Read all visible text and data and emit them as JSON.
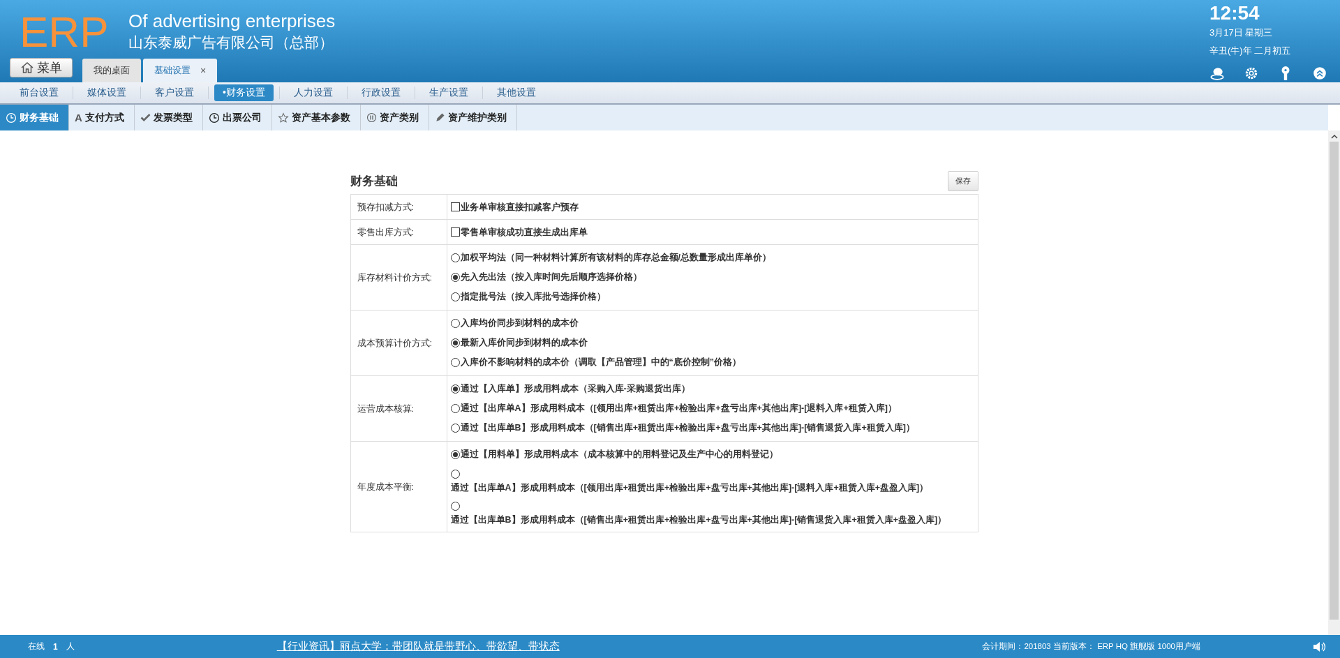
{
  "header": {
    "logo": "ERP",
    "title": "Of advertising enterprises",
    "company": "山东泰威广告有限公司（总部）",
    "clock": {
      "time": "12:54",
      "date": "3月17日 星期三",
      "lunar": "辛丑(牛)年 二月初五"
    }
  },
  "menu_button": {
    "label": "菜单"
  },
  "tabs": [
    {
      "label": "我的桌面",
      "selected": false
    },
    {
      "label": "基础设置",
      "selected": true,
      "close": "×"
    }
  ],
  "nav": [
    {
      "label": "前台设置",
      "selected": false
    },
    {
      "label": "媒体设置",
      "selected": false
    },
    {
      "label": "客户设置",
      "selected": false
    },
    {
      "label": "•财务设置",
      "selected": true
    },
    {
      "label": "人力设置",
      "selected": false
    },
    {
      "label": "行政设置",
      "selected": false
    },
    {
      "label": "生产设置",
      "selected": false
    },
    {
      "label": "其他设置",
      "selected": false
    }
  ],
  "subtabs": [
    {
      "label": "财务基础",
      "selected": true
    },
    {
      "label": "支付方式",
      "letter": "A",
      "selected": false
    },
    {
      "label": "发票类型",
      "selected": false
    },
    {
      "label": "出票公司",
      "selected": false
    },
    {
      "label": "资产基本参数",
      "selected": false
    },
    {
      "label": "资产类别",
      "selected": false
    },
    {
      "label": "资产维护类别",
      "selected": false
    }
  ],
  "panel": {
    "title": "财务基础",
    "save": "保存",
    "rows": [
      {
        "label": "预存扣减方式:",
        "options": [
          {
            "kind": "checkbox",
            "checked": false,
            "text": "业务单审核直接扣减客户预存"
          }
        ]
      },
      {
        "label": "零售出库方式:",
        "options": [
          {
            "kind": "checkbox",
            "checked": false,
            "text": "零售单审核成功直接生成出库单"
          }
        ]
      },
      {
        "label": "库存材料计价方式:",
        "options": [
          {
            "kind": "radio",
            "selected": false,
            "text": "加权平均法（同一种材料计算所有该材料的库存总金额/总数量形成出库单价）"
          },
          {
            "kind": "radio",
            "selected": true,
            "text": "先入先出法（按入库时间先后顺序选择价格）"
          },
          {
            "kind": "radio",
            "selected": false,
            "text": "指定批号法（按入库批号选择价格）"
          }
        ]
      },
      {
        "label": "成本预算计价方式:",
        "options": [
          {
            "kind": "radio",
            "selected": false,
            "text": "入库均价同步到材料的成本价"
          },
          {
            "kind": "radio",
            "selected": true,
            "text": "最新入库价同步到材料的成本价"
          },
          {
            "kind": "radio",
            "selected": false,
            "text": "入库价不影响材料的成本价（调取【产品管理】中的“底价控制”价格）"
          }
        ]
      },
      {
        "label": "运营成本核算:",
        "options": [
          {
            "kind": "radio",
            "selected": true,
            "text": "通过【入库单】形成用料成本（采购入库-采购退货出库）"
          },
          {
            "kind": "radio",
            "selected": false,
            "text": "通过【出库单A】形成用料成本（[领用出库+租赁出库+检验出库+盘亏出库+其他出库]-[退料入库+租赁入库]）"
          },
          {
            "kind": "radio",
            "selected": false,
            "text": "通过【出库单B】形成用料成本（[销售出库+租赁出库+检验出库+盘亏出库+其他出库]-[销售退货入库+租赁入库]）"
          }
        ]
      },
      {
        "label": "年度成本平衡:",
        "options": [
          {
            "kind": "radio",
            "selected": true,
            "text": "通过【用料单】形成用料成本（成本核算中的用料登记及生产中心的用料登记）"
          },
          {
            "kind": "radio_stacked",
            "selected": false,
            "text": "通过【出库单A】形成用料成本（[领用出库+租赁出库+检验出库+盘亏出库+其他出库]-[退料入库+租赁入库+盘盈入库]）"
          },
          {
            "kind": "radio_stacked",
            "selected": false,
            "text": "通过【出库单B】形成用料成本（[销售出库+租赁出库+检验出库+盘亏出库+其他出库]-[销售退货入库+租赁入库+盘盈入库]）"
          }
        ]
      }
    ]
  },
  "status_bar": {
    "online_label": "在线",
    "online_count": "1",
    "online_unit": "人",
    "news": "【行业资讯】丽点大学：带团队就是带野心、带欲望、带状态",
    "info": "会计期间：201803 当前版本： ERP HQ 旗舰版 1000用户端"
  }
}
